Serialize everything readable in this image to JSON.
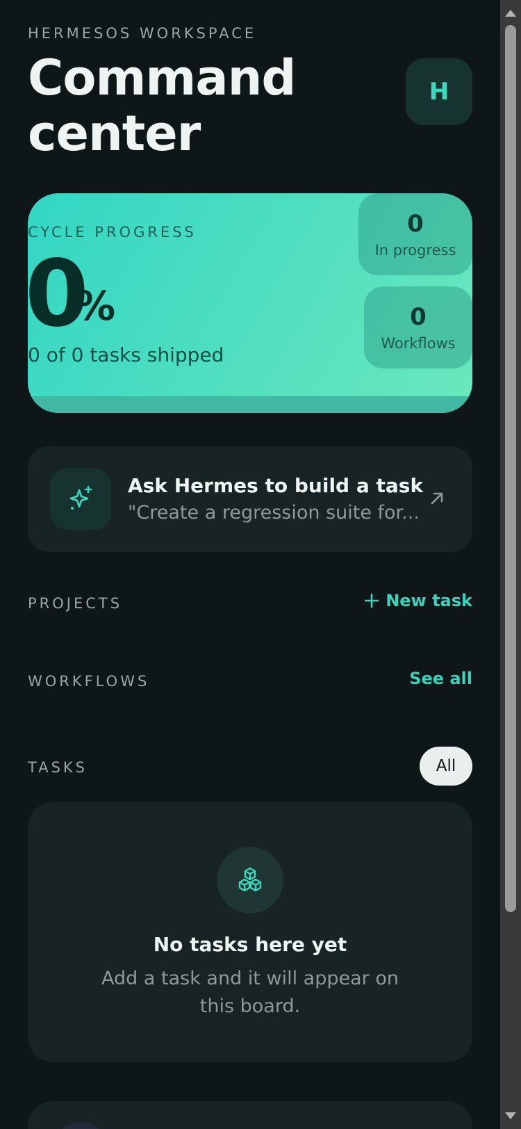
{
  "header": {
    "workspace": "HERMESOS WORKSPACE",
    "title_line1": "Command",
    "title_line2": "center",
    "avatar_initial": "H"
  },
  "progress": {
    "label": "CYCLE PROGRESS",
    "percent_value": "0",
    "percent_sign": "%",
    "percent_fraction": 0,
    "shipped_text": "0 of 0 tasks shipped",
    "stats": [
      {
        "value": "0",
        "label": "In progress"
      },
      {
        "value": "0",
        "label": "Workflows"
      }
    ]
  },
  "ask": {
    "title": "Ask Hermes to build a task",
    "subtitle": "\"Create a regression suite for..."
  },
  "sections": {
    "projects_label": "PROJECTS",
    "new_task_label": "New task",
    "workflows_label": "WORKFLOWS",
    "see_all_label": "See all",
    "tasks_label": "TASKS",
    "filter_label": "All"
  },
  "empty_state": {
    "title": "No tasks here yet",
    "subtitle": "Add a task and it will appear on this board."
  },
  "colors": {
    "accent": "#38d3bb",
    "background": "#0e1617",
    "card": "#172324"
  },
  "icons": {
    "ask": "sparkle-icon",
    "ask_arrow": "arrow-up-right-icon",
    "new_task": "plus-icon",
    "empty": "cubes-icon"
  }
}
